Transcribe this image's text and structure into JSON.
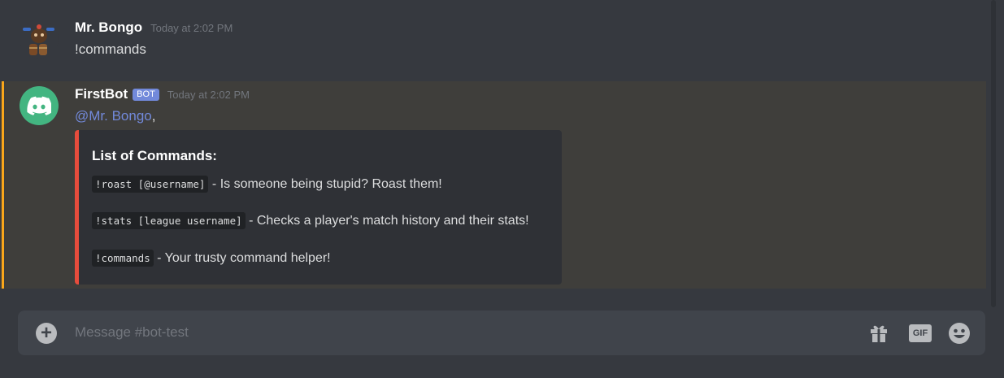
{
  "messages": [
    {
      "author": "Mr. Bongo",
      "timestamp": "Today at 2:02 PM",
      "text": "!commands"
    },
    {
      "author": "FirstBot",
      "bot_tag": "BOT",
      "timestamp": "Today at 2:02 PM",
      "mention": "@Mr. Bongo",
      "mention_suffix": ",",
      "embed": {
        "accent_color": "#e74c3c",
        "title": "List of Commands:",
        "lines": [
          {
            "code": "!roast [@username]",
            "text": " - Is someone being stupid? Roast them!"
          },
          {
            "code": "!stats [league username]",
            "text": " - Checks a player's match history and their stats!"
          },
          {
            "code": "!commands",
            "text": " - Your trusty command helper!"
          }
        ]
      }
    }
  ],
  "composer": {
    "placeholder": "Message #bot-test",
    "plus_icon": "+",
    "gif_label": "GIF"
  },
  "colors": {
    "background": "#36393f",
    "mention_highlight": "#faa61a",
    "blurple": "#7289da",
    "bot_avatar": "#43b581"
  }
}
